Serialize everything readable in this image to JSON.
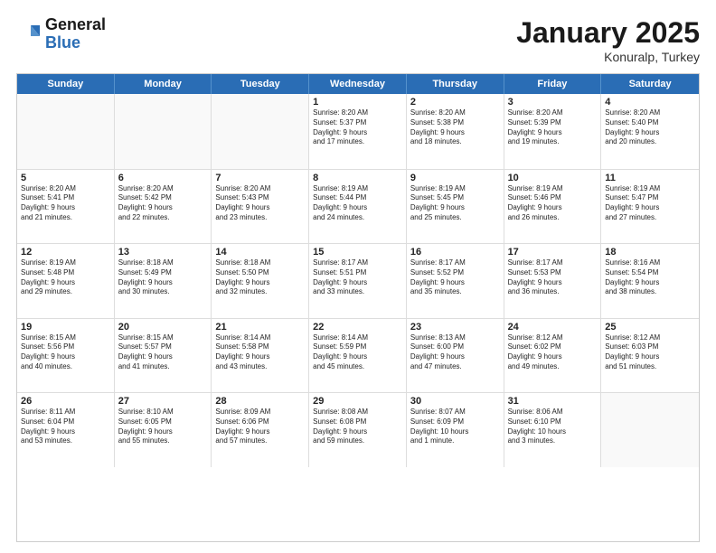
{
  "logo": {
    "general": "General",
    "blue": "Blue"
  },
  "title": "January 2025",
  "location": "Konuralp, Turkey",
  "days": [
    "Sunday",
    "Monday",
    "Tuesday",
    "Wednesday",
    "Thursday",
    "Friday",
    "Saturday"
  ],
  "weeks": [
    [
      {
        "day": "",
        "text": ""
      },
      {
        "day": "",
        "text": ""
      },
      {
        "day": "",
        "text": ""
      },
      {
        "day": "1",
        "text": "Sunrise: 8:20 AM\nSunset: 5:37 PM\nDaylight: 9 hours\nand 17 minutes."
      },
      {
        "day": "2",
        "text": "Sunrise: 8:20 AM\nSunset: 5:38 PM\nDaylight: 9 hours\nand 18 minutes."
      },
      {
        "day": "3",
        "text": "Sunrise: 8:20 AM\nSunset: 5:39 PM\nDaylight: 9 hours\nand 19 minutes."
      },
      {
        "day": "4",
        "text": "Sunrise: 8:20 AM\nSunset: 5:40 PM\nDaylight: 9 hours\nand 20 minutes."
      }
    ],
    [
      {
        "day": "5",
        "text": "Sunrise: 8:20 AM\nSunset: 5:41 PM\nDaylight: 9 hours\nand 21 minutes."
      },
      {
        "day": "6",
        "text": "Sunrise: 8:20 AM\nSunset: 5:42 PM\nDaylight: 9 hours\nand 22 minutes."
      },
      {
        "day": "7",
        "text": "Sunrise: 8:20 AM\nSunset: 5:43 PM\nDaylight: 9 hours\nand 23 minutes."
      },
      {
        "day": "8",
        "text": "Sunrise: 8:19 AM\nSunset: 5:44 PM\nDaylight: 9 hours\nand 24 minutes."
      },
      {
        "day": "9",
        "text": "Sunrise: 8:19 AM\nSunset: 5:45 PM\nDaylight: 9 hours\nand 25 minutes."
      },
      {
        "day": "10",
        "text": "Sunrise: 8:19 AM\nSunset: 5:46 PM\nDaylight: 9 hours\nand 26 minutes."
      },
      {
        "day": "11",
        "text": "Sunrise: 8:19 AM\nSunset: 5:47 PM\nDaylight: 9 hours\nand 27 minutes."
      }
    ],
    [
      {
        "day": "12",
        "text": "Sunrise: 8:19 AM\nSunset: 5:48 PM\nDaylight: 9 hours\nand 29 minutes."
      },
      {
        "day": "13",
        "text": "Sunrise: 8:18 AM\nSunset: 5:49 PM\nDaylight: 9 hours\nand 30 minutes."
      },
      {
        "day": "14",
        "text": "Sunrise: 8:18 AM\nSunset: 5:50 PM\nDaylight: 9 hours\nand 32 minutes."
      },
      {
        "day": "15",
        "text": "Sunrise: 8:17 AM\nSunset: 5:51 PM\nDaylight: 9 hours\nand 33 minutes."
      },
      {
        "day": "16",
        "text": "Sunrise: 8:17 AM\nSunset: 5:52 PM\nDaylight: 9 hours\nand 35 minutes."
      },
      {
        "day": "17",
        "text": "Sunrise: 8:17 AM\nSunset: 5:53 PM\nDaylight: 9 hours\nand 36 minutes."
      },
      {
        "day": "18",
        "text": "Sunrise: 8:16 AM\nSunset: 5:54 PM\nDaylight: 9 hours\nand 38 minutes."
      }
    ],
    [
      {
        "day": "19",
        "text": "Sunrise: 8:15 AM\nSunset: 5:56 PM\nDaylight: 9 hours\nand 40 minutes."
      },
      {
        "day": "20",
        "text": "Sunrise: 8:15 AM\nSunset: 5:57 PM\nDaylight: 9 hours\nand 41 minutes."
      },
      {
        "day": "21",
        "text": "Sunrise: 8:14 AM\nSunset: 5:58 PM\nDaylight: 9 hours\nand 43 minutes."
      },
      {
        "day": "22",
        "text": "Sunrise: 8:14 AM\nSunset: 5:59 PM\nDaylight: 9 hours\nand 45 minutes."
      },
      {
        "day": "23",
        "text": "Sunrise: 8:13 AM\nSunset: 6:00 PM\nDaylight: 9 hours\nand 47 minutes."
      },
      {
        "day": "24",
        "text": "Sunrise: 8:12 AM\nSunset: 6:02 PM\nDaylight: 9 hours\nand 49 minutes."
      },
      {
        "day": "25",
        "text": "Sunrise: 8:12 AM\nSunset: 6:03 PM\nDaylight: 9 hours\nand 51 minutes."
      }
    ],
    [
      {
        "day": "26",
        "text": "Sunrise: 8:11 AM\nSunset: 6:04 PM\nDaylight: 9 hours\nand 53 minutes."
      },
      {
        "day": "27",
        "text": "Sunrise: 8:10 AM\nSunset: 6:05 PM\nDaylight: 9 hours\nand 55 minutes."
      },
      {
        "day": "28",
        "text": "Sunrise: 8:09 AM\nSunset: 6:06 PM\nDaylight: 9 hours\nand 57 minutes."
      },
      {
        "day": "29",
        "text": "Sunrise: 8:08 AM\nSunset: 6:08 PM\nDaylight: 9 hours\nand 59 minutes."
      },
      {
        "day": "30",
        "text": "Sunrise: 8:07 AM\nSunset: 6:09 PM\nDaylight: 10 hours\nand 1 minute."
      },
      {
        "day": "31",
        "text": "Sunrise: 8:06 AM\nSunset: 6:10 PM\nDaylight: 10 hours\nand 3 minutes."
      },
      {
        "day": "",
        "text": ""
      }
    ]
  ]
}
